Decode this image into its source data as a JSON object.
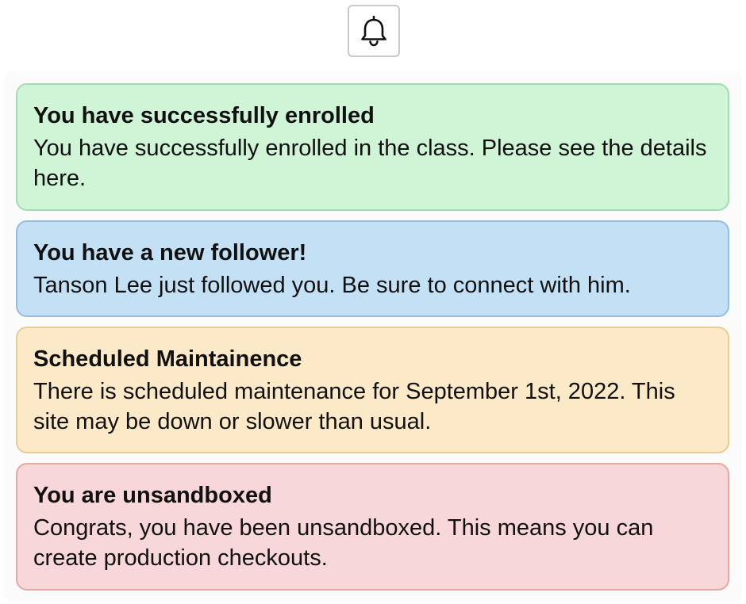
{
  "header": {
    "bell_icon": "bell-icon"
  },
  "alerts": [
    {
      "variant": "success",
      "title": "You have successfully enrolled",
      "message": "You have successfully enrolled in the class. Please see the details here.",
      "background": "#cff4d6",
      "border": "#a3dcb0"
    },
    {
      "variant": "info",
      "title": "You have a new follower!",
      "message": "Tanson Lee just followed you. Be sure to connect with him.",
      "background": "#c4e0f5",
      "border": "#93bee0"
    },
    {
      "variant": "warning",
      "title": "Scheduled Maintainence",
      "message": "There is scheduled maintenance for September 1st, 2022. This site may be down or slower than usual.",
      "background": "#fbe9c8",
      "border": "#e7cd98"
    },
    {
      "variant": "danger",
      "title": "You are unsandboxed",
      "message": "Congrats, you have been unsandboxed. This means you can create production checkouts.",
      "background": "#f7d7d9",
      "border": "#e3a9a4"
    }
  ]
}
